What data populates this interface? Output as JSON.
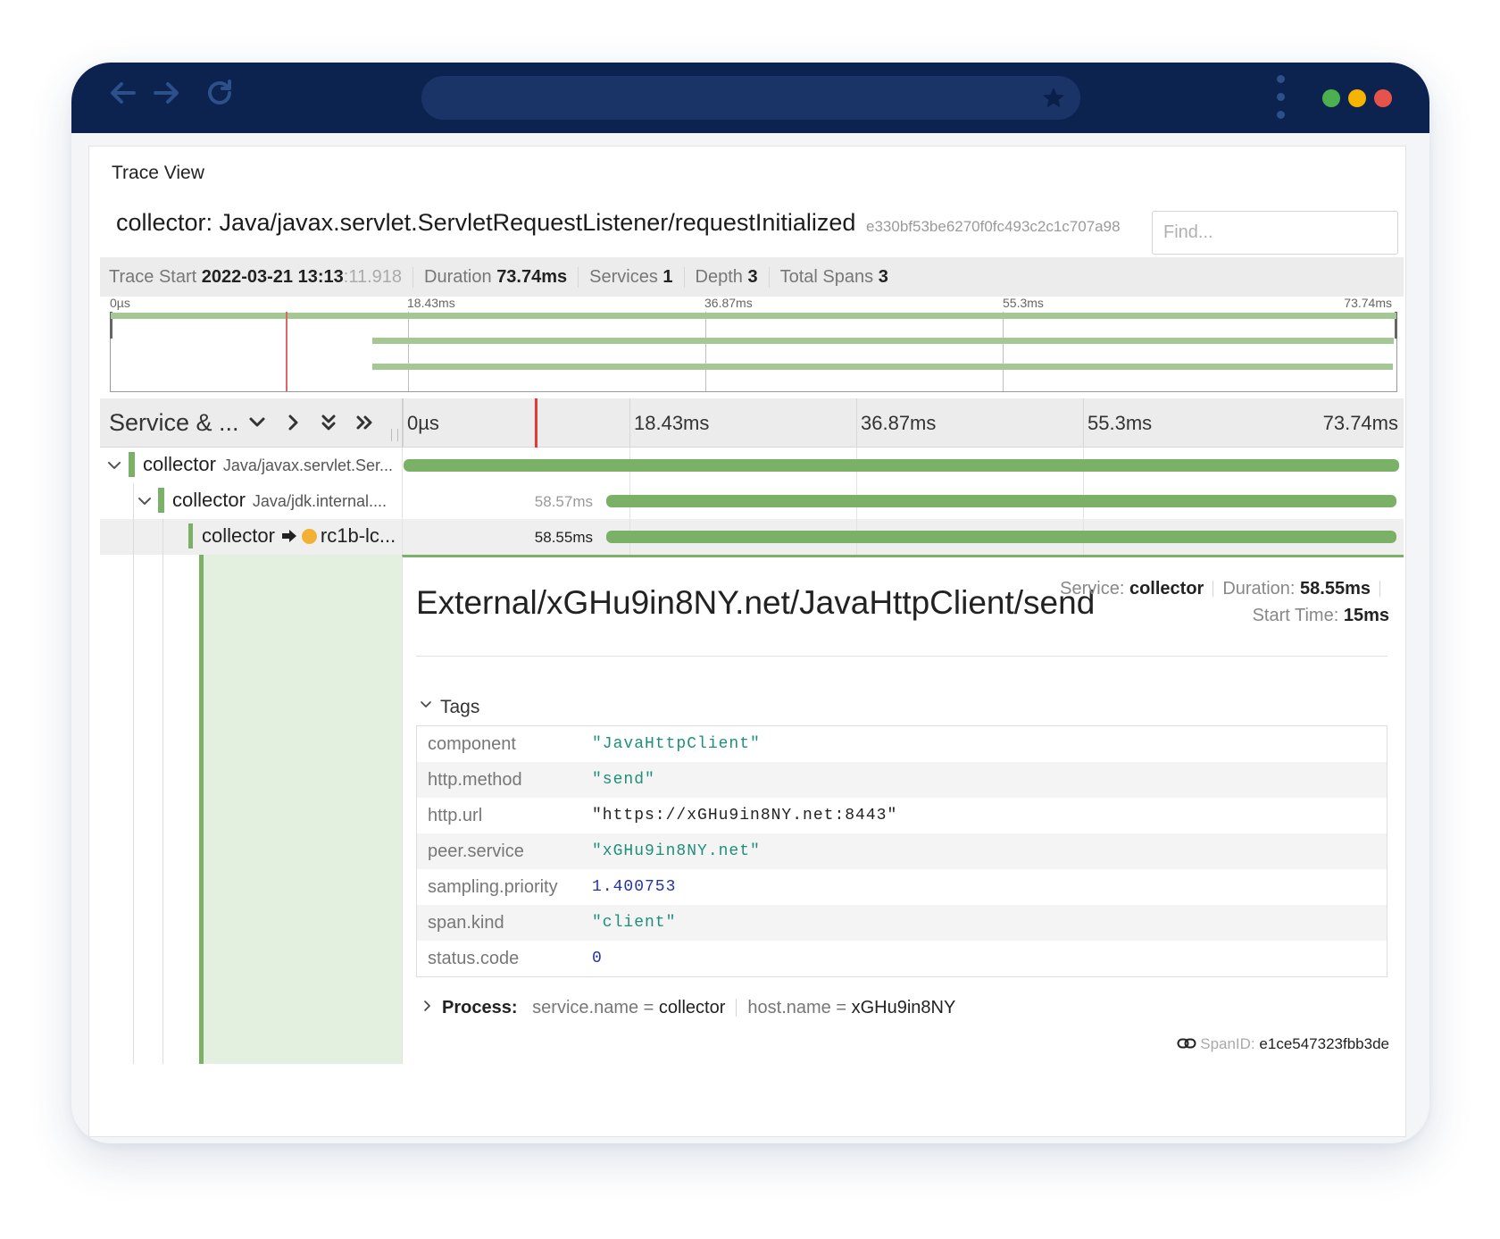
{
  "colors": {
    "chrome": "#0c2350",
    "span_bar": "#7ab167",
    "cursor": "#e53935",
    "traffic_green": "#4caf50",
    "traffic_yellow": "#f4b400",
    "traffic_red": "#e5534b"
  },
  "icons": {
    "back": "arrow-left-icon",
    "forward": "arrow-right-icon",
    "reload": "reload-icon",
    "bookmark": "star-icon",
    "menu": "kebab-icon"
  },
  "page": {
    "section_title": "Trace View"
  },
  "trace": {
    "name": "collector: Java/javax.servlet.ServletRequestListener/requestInitialized",
    "id": "e330bf53be6270f0fc493c2c1c707a98",
    "find_placeholder": "Find...",
    "meta": {
      "start_label": "Trace Start",
      "start_date": "2022-03-21 13:13",
      "start_ms": ":11.918",
      "duration_label": "Duration",
      "duration": "73.74ms",
      "services_label": "Services",
      "services": "1",
      "depth_label": "Depth",
      "depth": "3",
      "spans_label": "Total Spans",
      "spans": "3"
    }
  },
  "timeline": {
    "column_title": "Service & ...",
    "ticks": [
      "0µs",
      "18.43ms",
      "36.87ms",
      "55.3ms",
      "73.74ms"
    ],
    "total_ms": 73.74,
    "cursor_ms": 10
  },
  "spans": [
    {
      "service": "collector",
      "operation": "Java/javax.servlet.Ser...",
      "start_ms": 0,
      "duration_ms": 73.74,
      "duration_label": ""
    },
    {
      "service": "collector",
      "operation": "Java/jdk.internal....",
      "start_ms": 15.0,
      "duration_ms": 58.57,
      "duration_label": "58.57ms"
    },
    {
      "service": "collector",
      "peer": "rc1b-lc...",
      "start_ms": 15.0,
      "duration_ms": 58.55,
      "duration_label": "58.55ms"
    }
  ],
  "detail": {
    "operation": "External/xGHu9in8NY.net/JavaHttpClient/send",
    "service_label": "Service:",
    "service": "collector",
    "duration_label": "Duration:",
    "duration": "58.55ms",
    "start_label": "Start Time:",
    "start": "15ms",
    "tags_title": "Tags",
    "tags": [
      {
        "key": "component",
        "value": "\"JavaHttpClient\"",
        "kind": "str"
      },
      {
        "key": "http.method",
        "value": "\"send\"",
        "kind": "str"
      },
      {
        "key": "http.url",
        "value": "\"https://xGHu9in8NY.net:8443\"",
        "kind": "plain"
      },
      {
        "key": "peer.service",
        "value": "\"xGHu9in8NY.net\"",
        "kind": "str"
      },
      {
        "key": "sampling.priority",
        "value": "1.400753",
        "kind": "num"
      },
      {
        "key": "span.kind",
        "value": "\"client\"",
        "kind": "str"
      },
      {
        "key": "status.code",
        "value": "0",
        "kind": "num"
      }
    ],
    "process_title": "Process:",
    "process": [
      {
        "key": "service.name",
        "value": "collector"
      },
      {
        "key": "host.name",
        "value": "xGHu9in8NY"
      }
    ],
    "span_id_label": "SpanID:",
    "span_id": "e1ce547323fbb3de"
  }
}
